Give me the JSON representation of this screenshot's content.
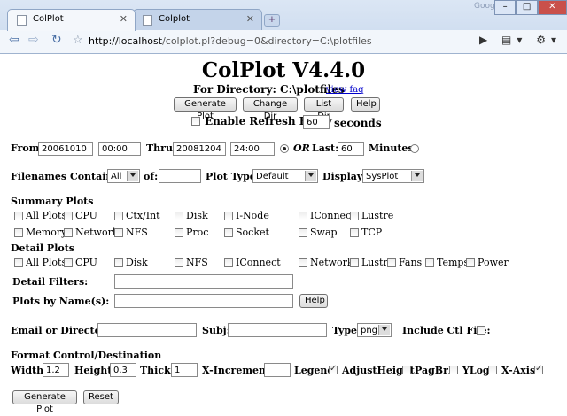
{
  "browser": {
    "tabs": [
      {
        "title": "ColPlot"
      },
      {
        "title": "Colplot"
      }
    ],
    "newtab": "+",
    "logo": "Google",
    "url_host": "http://localhost",
    "url_rest": "/colplot.pl?debug=0&directory=C:\\plotfiles"
  },
  "header": {
    "title": "ColPlot V4.4.0",
    "dir_label": "For Directory: C:\\plotfiles",
    "view_faq": "view faq"
  },
  "buttons": {
    "generate": "Generate Plot",
    "change_dir": "Change Dir",
    "list_dir": "List Dir",
    "help": "Help",
    "help2": "Help",
    "generate2": "Generate Plot",
    "reset": "Reset"
  },
  "refresh": {
    "label": "Enable Refresh Every",
    "value": "60",
    "unit": "seconds"
  },
  "time": {
    "from_label": "From:",
    "from_date": "20061010",
    "from_time": "00:00",
    "thru_label": "Thru:",
    "thru_date": "20081204",
    "thru_time": "24:00",
    "or_label": "OR",
    "last_label": "Last:",
    "last_value": "60",
    "minutes_label": "Minutes"
  },
  "filenames": {
    "label": "Filenames Containing",
    "select": "All",
    "of_label": "of:",
    "of_value": "",
    "plottype_label": "Plot Type:",
    "plottype": "Default",
    "display_label": "Display:",
    "display": "SysPlot"
  },
  "summary": {
    "title": "Summary Plots",
    "items": [
      "All Plots",
      "CPU",
      "Ctx/Int",
      "Disk",
      "I-Node",
      "IConnect",
      "Lustre",
      "Memory",
      "Network",
      "NFS",
      "Proc",
      "Socket",
      "Swap",
      "TCP"
    ]
  },
  "detail": {
    "title": "Detail Plots",
    "items": [
      "All Plots",
      "CPU",
      "Disk",
      "NFS",
      "IConnect",
      "Network",
      "Lustre",
      "Fans",
      "Temps",
      "Power"
    ],
    "filters_label": "Detail Filters:",
    "byname_label": "Plots by Name(s):"
  },
  "email": {
    "label": "Email or Directory:",
    "subj_label": "Subj:",
    "type_label": "Type",
    "type_value": "png",
    "ctl_label": "Include Ctl File:"
  },
  "format": {
    "title": "Format Control/Destination",
    "width_label": "Width:",
    "width": "1.2",
    "height_label": "Height:",
    "height": "0.3",
    "thick_label": "Thick:",
    "thick": "1",
    "xinc_label": "X-Increment:",
    "xinc": "",
    "legend": "Legend",
    "adjust": "AdjustHeight",
    "pagbrk": "PagBrk",
    "ylog": "YLog",
    "xaxis": "X-Axis"
  }
}
